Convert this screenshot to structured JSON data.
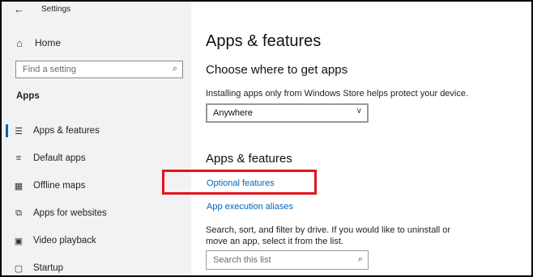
{
  "window": {
    "title": "Settings",
    "back_glyph": "←"
  },
  "sidebar": {
    "home": {
      "label": "Home",
      "icon": "home-icon",
      "glyph": "⌂"
    },
    "search": {
      "placeholder": "Find a setting",
      "icon": "search-icon",
      "glyph": "⌕"
    },
    "section_title": "Apps",
    "items": [
      {
        "label": "Apps & features",
        "icon": "apps-features-icon",
        "glyph": "☰",
        "selected": true
      },
      {
        "label": "Default apps",
        "icon": "default-apps-icon",
        "glyph": "≡",
        "selected": false
      },
      {
        "label": "Offline maps",
        "icon": "offline-maps-icon",
        "glyph": "▦",
        "selected": false
      },
      {
        "label": "Apps for websites",
        "icon": "apps-for-websites-icon",
        "glyph": "⧉",
        "selected": false
      },
      {
        "label": "Video playback",
        "icon": "video-playback-icon",
        "glyph": "▣",
        "selected": false
      },
      {
        "label": "Startup",
        "icon": "startup-icon",
        "glyph": "▢",
        "selected": false
      }
    ]
  },
  "main": {
    "page_title": "Apps & features",
    "choose_section": {
      "heading": "Choose where to get apps",
      "description": "Installing apps only from Windows Store helps protect your device.",
      "dropdown_value": "Anywhere",
      "dropdown_chevron": "∨"
    },
    "features_section": {
      "heading": "Apps & features",
      "links": [
        "Optional features",
        "App execution aliases"
      ],
      "description_line1": "Search, sort, and filter by drive. If you would like to uninstall or",
      "description_line2": "move an app, select it from the list.",
      "search_placeholder": "Search this list",
      "search_glyph": "⌕"
    }
  },
  "colors": {
    "accent": "#0067b8",
    "highlight": "#e3141a",
    "sidebar_bg": "#f2f2f2"
  }
}
